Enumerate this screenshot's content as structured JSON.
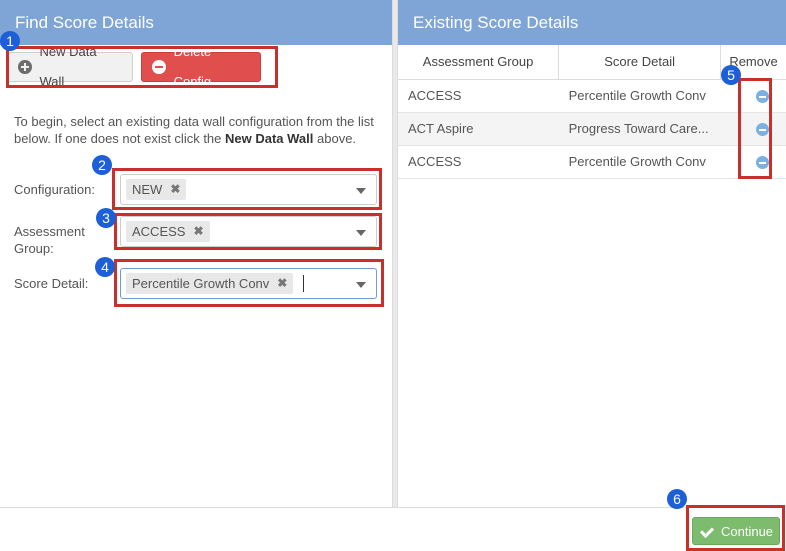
{
  "left_panel": {
    "title": "Find Score Details",
    "new_data_wall_label": "New Data Wall",
    "delete_config_label": "Delete Config",
    "intro_text_1": "To begin, select an existing data wall configuration from the list below. If one does not exist click the ",
    "intro_bold": "New Data Wall",
    "intro_text_2": " above.",
    "configuration_label": "Configuration:",
    "configuration_value": "NEW",
    "assessment_group_label": "Assessment Group:",
    "assessment_group_value": "ACCESS",
    "score_detail_label": "Score Detail:",
    "score_detail_value": "Percentile Growth Conv",
    "tag_remove_glyph": "✖"
  },
  "right_panel": {
    "title": "Existing Score Details",
    "columns": [
      "Assessment Group",
      "Score Detail",
      "Remove"
    ],
    "rows": [
      {
        "group": "ACCESS",
        "detail": "Percentile Growth Conv"
      },
      {
        "group": "ACT Aspire",
        "detail": "Progress Toward Care..."
      },
      {
        "group": "ACCESS",
        "detail": "Percentile Growth Conv"
      }
    ]
  },
  "footer": {
    "continue_label": "Continue"
  },
  "annotations": [
    "1",
    "2",
    "3",
    "4",
    "5",
    "6"
  ],
  "colors": {
    "header": "#7ea5d6",
    "danger": "#e04e4e",
    "success": "#7dbb6e",
    "highlight": "#c9302c",
    "badge": "#1d5fd6"
  }
}
